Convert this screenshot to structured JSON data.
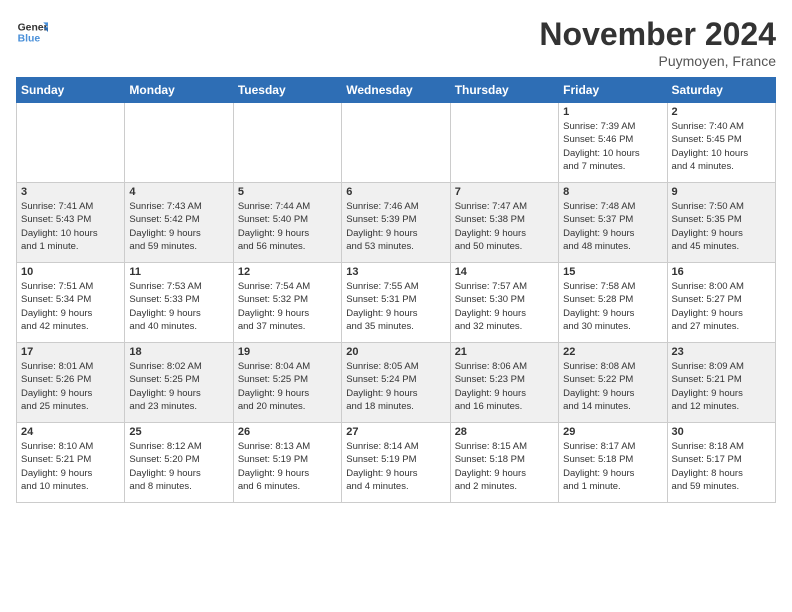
{
  "header": {
    "logo_line1": "General",
    "logo_line2": "Blue",
    "month_title": "November 2024",
    "location": "Puymoyen, France"
  },
  "columns": [
    "Sunday",
    "Monday",
    "Tuesday",
    "Wednesday",
    "Thursday",
    "Friday",
    "Saturday"
  ],
  "weeks": [
    {
      "days": [
        {
          "num": "",
          "info": "",
          "empty": true
        },
        {
          "num": "",
          "info": "",
          "empty": true
        },
        {
          "num": "",
          "info": "",
          "empty": true
        },
        {
          "num": "",
          "info": "",
          "empty": true
        },
        {
          "num": "",
          "info": "",
          "empty": true
        },
        {
          "num": "1",
          "info": "Sunrise: 7:39 AM\nSunset: 5:46 PM\nDaylight: 10 hours\nand 7 minutes."
        },
        {
          "num": "2",
          "info": "Sunrise: 7:40 AM\nSunset: 5:45 PM\nDaylight: 10 hours\nand 4 minutes."
        }
      ]
    },
    {
      "days": [
        {
          "num": "3",
          "info": "Sunrise: 7:41 AM\nSunset: 5:43 PM\nDaylight: 10 hours\nand 1 minute."
        },
        {
          "num": "4",
          "info": "Sunrise: 7:43 AM\nSunset: 5:42 PM\nDaylight: 9 hours\nand 59 minutes."
        },
        {
          "num": "5",
          "info": "Sunrise: 7:44 AM\nSunset: 5:40 PM\nDaylight: 9 hours\nand 56 minutes."
        },
        {
          "num": "6",
          "info": "Sunrise: 7:46 AM\nSunset: 5:39 PM\nDaylight: 9 hours\nand 53 minutes."
        },
        {
          "num": "7",
          "info": "Sunrise: 7:47 AM\nSunset: 5:38 PM\nDaylight: 9 hours\nand 50 minutes."
        },
        {
          "num": "8",
          "info": "Sunrise: 7:48 AM\nSunset: 5:37 PM\nDaylight: 9 hours\nand 48 minutes."
        },
        {
          "num": "9",
          "info": "Sunrise: 7:50 AM\nSunset: 5:35 PM\nDaylight: 9 hours\nand 45 minutes."
        }
      ]
    },
    {
      "days": [
        {
          "num": "10",
          "info": "Sunrise: 7:51 AM\nSunset: 5:34 PM\nDaylight: 9 hours\nand 42 minutes."
        },
        {
          "num": "11",
          "info": "Sunrise: 7:53 AM\nSunset: 5:33 PM\nDaylight: 9 hours\nand 40 minutes."
        },
        {
          "num": "12",
          "info": "Sunrise: 7:54 AM\nSunset: 5:32 PM\nDaylight: 9 hours\nand 37 minutes."
        },
        {
          "num": "13",
          "info": "Sunrise: 7:55 AM\nSunset: 5:31 PM\nDaylight: 9 hours\nand 35 minutes."
        },
        {
          "num": "14",
          "info": "Sunrise: 7:57 AM\nSunset: 5:30 PM\nDaylight: 9 hours\nand 32 minutes."
        },
        {
          "num": "15",
          "info": "Sunrise: 7:58 AM\nSunset: 5:28 PM\nDaylight: 9 hours\nand 30 minutes."
        },
        {
          "num": "16",
          "info": "Sunrise: 8:00 AM\nSunset: 5:27 PM\nDaylight: 9 hours\nand 27 minutes."
        }
      ]
    },
    {
      "days": [
        {
          "num": "17",
          "info": "Sunrise: 8:01 AM\nSunset: 5:26 PM\nDaylight: 9 hours\nand 25 minutes."
        },
        {
          "num": "18",
          "info": "Sunrise: 8:02 AM\nSunset: 5:25 PM\nDaylight: 9 hours\nand 23 minutes."
        },
        {
          "num": "19",
          "info": "Sunrise: 8:04 AM\nSunset: 5:25 PM\nDaylight: 9 hours\nand 20 minutes."
        },
        {
          "num": "20",
          "info": "Sunrise: 8:05 AM\nSunset: 5:24 PM\nDaylight: 9 hours\nand 18 minutes."
        },
        {
          "num": "21",
          "info": "Sunrise: 8:06 AM\nSunset: 5:23 PM\nDaylight: 9 hours\nand 16 minutes."
        },
        {
          "num": "22",
          "info": "Sunrise: 8:08 AM\nSunset: 5:22 PM\nDaylight: 9 hours\nand 14 minutes."
        },
        {
          "num": "23",
          "info": "Sunrise: 8:09 AM\nSunset: 5:21 PM\nDaylight: 9 hours\nand 12 minutes."
        }
      ]
    },
    {
      "days": [
        {
          "num": "24",
          "info": "Sunrise: 8:10 AM\nSunset: 5:21 PM\nDaylight: 9 hours\nand 10 minutes."
        },
        {
          "num": "25",
          "info": "Sunrise: 8:12 AM\nSunset: 5:20 PM\nDaylight: 9 hours\nand 8 minutes."
        },
        {
          "num": "26",
          "info": "Sunrise: 8:13 AM\nSunset: 5:19 PM\nDaylight: 9 hours\nand 6 minutes."
        },
        {
          "num": "27",
          "info": "Sunrise: 8:14 AM\nSunset: 5:19 PM\nDaylight: 9 hours\nand 4 minutes."
        },
        {
          "num": "28",
          "info": "Sunrise: 8:15 AM\nSunset: 5:18 PM\nDaylight: 9 hours\nand 2 minutes."
        },
        {
          "num": "29",
          "info": "Sunrise: 8:17 AM\nSunset: 5:18 PM\nDaylight: 9 hours\nand 1 minute."
        },
        {
          "num": "30",
          "info": "Sunrise: 8:18 AM\nSunset: 5:17 PM\nDaylight: 8 hours\nand 59 minutes."
        }
      ]
    }
  ]
}
